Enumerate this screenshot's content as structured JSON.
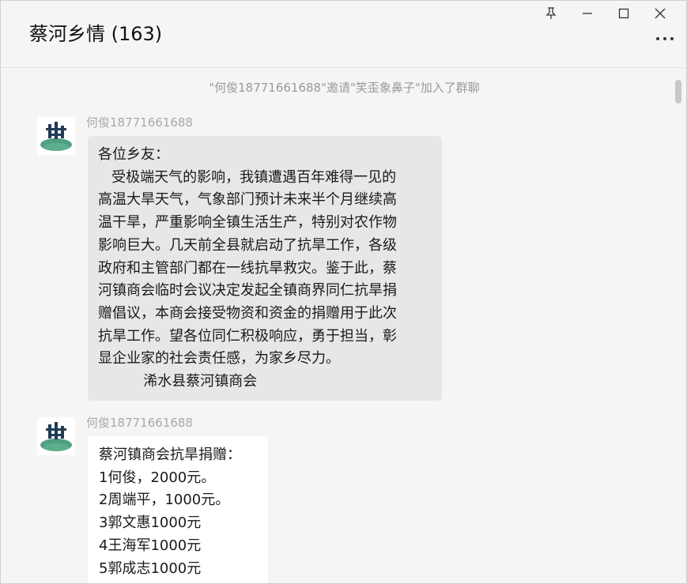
{
  "window": {
    "title": "蔡河乡情 (163)",
    "controls": {
      "pin_icon": "pin-icon",
      "minimize_icon": "minimize-icon",
      "maximize_icon": "maximize-icon",
      "close_icon": "close-icon",
      "more_icon": "more-icon"
    }
  },
  "chat": {
    "system_message": "\"何俊18771661688\"邀请\"笑歪象鼻子\"加入了群聊",
    "messages": [
      {
        "sender": "何俊18771661688",
        "lines": [
          "各位乡友：",
          "   受极端天气的影响，我镇遭遇百年难得一见的",
          "高温大旱天气，气象部门预计未来半个月继续高",
          "温干旱，严重影响全镇生活生产，特别对农作物",
          "影响巨大。几天前全县就启动了抗旱工作，各级",
          "政府和主管部门都在一线抗旱救灾。鉴于此，蔡",
          "河镇商会临时会议决定发起全镇商界同仁抗旱捐",
          "赠倡议，本商会接受物资和资金的捐赠用于此次",
          "抗旱工作。望各位同仁积极响应，勇于担当，彰",
          "显企业家的社会责任感，为家乡尽力。",
          "          浠水县蔡河镇商会"
        ]
      },
      {
        "sender": "何俊18771661688",
        "lines": [
          "蔡河镇商会抗旱捐赠：",
          "1何俊，2000元。",
          "2周端平，1000元。",
          "3郭文惠1000元",
          "4王海军1000元",
          "5郭成志1000元"
        ]
      }
    ]
  },
  "colors": {
    "background": "#f5f5f5",
    "bubble_gray": "#e7e7e7",
    "bubble_white": "#ffffff",
    "meta_text": "#a8a8a8",
    "avatar_green": "#2f8f6a"
  }
}
